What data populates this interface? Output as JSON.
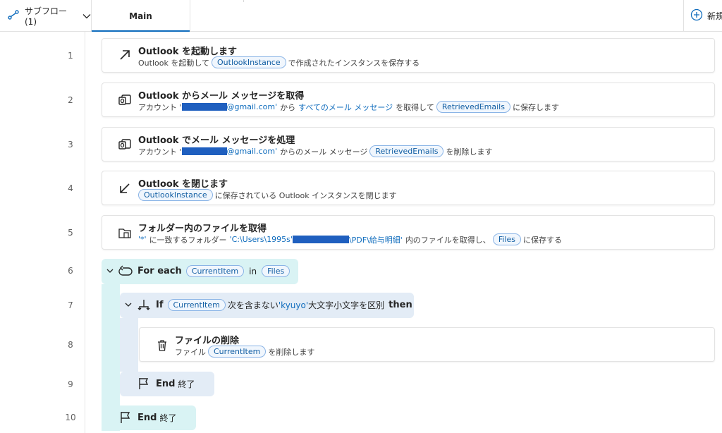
{
  "topbar": {
    "subflow_label": "サブフロー (1)",
    "main_tab": "Main",
    "new_label": "新規"
  },
  "lines": [
    "1",
    "2",
    "3",
    "4",
    "5",
    "6",
    "7",
    "8",
    "9",
    "10"
  ],
  "steps": {
    "s1": {
      "title": "Outlook を起動します",
      "pre": "Outlook を起動して",
      "var": "OutlookInstance",
      "post": "で作成されたインスタンスを保存する"
    },
    "s2": {
      "title": "Outlook からメール メッセージを取得",
      "pre": "アカウント '",
      "email": "@gmail.com'",
      "from": "から",
      "link": "すべてのメール メッセージ",
      "mid": "を取得して",
      "var": "RetrievedEmails",
      "post": "に保存します"
    },
    "s3": {
      "title": "Outlook でメール メッセージを処理",
      "pre": "アカウント '",
      "email": "@gmail.com'",
      "mid": "からのメール メッセージ",
      "var": "RetrievedEmails",
      "post": "を削除します"
    },
    "s4": {
      "title": "Outlook を閉じます",
      "var": "OutlookInstance",
      "post": "に保存されている Outlook インスタンスを閉じます"
    },
    "s5": {
      "title": "フォルダー内のファイルを取得",
      "pattern": "'*'",
      "pre": "に一致するフォルダー",
      "path_a": "'C:\\Users\\1995s'",
      "path_b": "\\PDF\\給与明細'",
      "mid": "内のファイルを取得し、",
      "var": "Files",
      "post": "に保存する"
    },
    "foreach": {
      "keyword": "For each",
      "var": "CurrentItem",
      "in": "in",
      "list": "Files"
    },
    "if": {
      "keyword": "If",
      "var": "CurrentItem",
      "cond": "次を含まない",
      "value": "'kyuyo'",
      "case": "大文字小文字を区別",
      "then": "then"
    },
    "s8": {
      "title": "ファイルの削除",
      "pre": "ファイル",
      "var": "CurrentItem",
      "post": "を削除します"
    },
    "end_if": {
      "keyword": "End",
      "label": "終了"
    },
    "end_for": {
      "keyword": "End",
      "label": "終了"
    }
  },
  "colors": {
    "accent": "#0f6cbd",
    "block_bg": "#d9f3f4",
    "if_bg": "#e3ecf6",
    "redaction": "#1f5fbf"
  }
}
